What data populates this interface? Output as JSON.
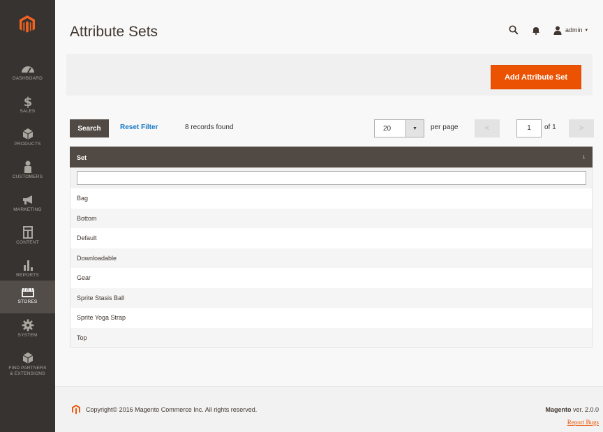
{
  "sidebar": {
    "items": [
      {
        "label": "DASHBOARD",
        "icon": "dashboard-icon"
      },
      {
        "label": "SALES",
        "icon": "dollar-icon"
      },
      {
        "label": "PRODUCTS",
        "icon": "cube-icon"
      },
      {
        "label": "CUSTOMERS",
        "icon": "user-icon"
      },
      {
        "label": "MARKETING",
        "icon": "megaphone-icon"
      },
      {
        "label": "CONTENT",
        "icon": "content-icon"
      },
      {
        "label": "REPORTS",
        "icon": "bar-chart-icon"
      },
      {
        "label": "STORES",
        "icon": "store-icon"
      },
      {
        "label": "SYSTEM",
        "icon": "gear-icon"
      },
      {
        "label": "FIND PARTNERS",
        "label2": "& EXTENSIONS",
        "icon": "partners-icon"
      }
    ],
    "active": "STORES"
  },
  "header": {
    "title": "Attribute Sets",
    "user": "admin"
  },
  "actions": {
    "add_label": "Add Attribute Set"
  },
  "grid": {
    "search_label": "Search",
    "reset_label": "Reset Filter",
    "records": "8 records found",
    "per_page_value": "20",
    "per_page_label": "per page",
    "page_value": "1",
    "of_label": "of 1",
    "column_header": "Set",
    "sort_indicator": "↓",
    "rows": [
      "Bag",
      "Bottom",
      "Default",
      "Downloadable",
      "Gear",
      "Sprite Stasis Ball",
      "Sprite Yoga Strap",
      "Top"
    ]
  },
  "footer": {
    "copyright": "Copyright© 2016 Magento Commerce Inc. All rights reserved.",
    "brand": "Magento",
    "version": " ver. 2.0.0",
    "report": "Report Bugs"
  },
  "colors": {
    "accent": "#eb5202",
    "sidebar": "#373330",
    "grid_header": "#514943",
    "link": "#1979c3"
  }
}
